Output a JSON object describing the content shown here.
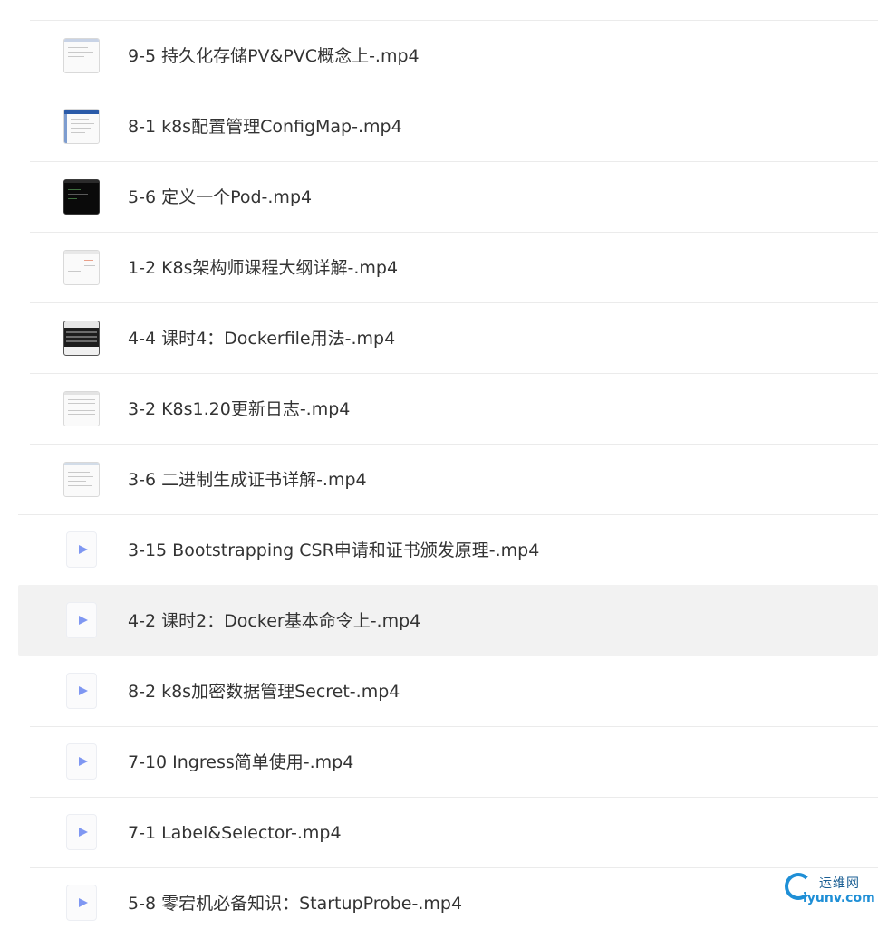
{
  "files": [
    {
      "name": "9-5 持久化存储PV&PVC概念上-.mp4",
      "thumb": "document-thumbnail",
      "selected": false
    },
    {
      "name": "8-1 k8s配置管理ConfigMap-.mp4",
      "thumb": "document-thumbnail",
      "selected": false
    },
    {
      "name": "5-6 定义一个Pod-.mp4",
      "thumb": "terminal-thumbnail",
      "selected": false
    },
    {
      "name": "1-2 K8s架构师课程大纲详解-.mp4",
      "thumb": "document-thumbnail",
      "selected": false
    },
    {
      "name": "4-4 课时4：Dockerfile用法-.mp4",
      "thumb": "table-thumbnail",
      "selected": false
    },
    {
      "name": "3-2 K8s1.20更新日志-.mp4",
      "thumb": "document-thumbnail",
      "selected": false
    },
    {
      "name": "3-6 二进制生成证书详解-.mp4",
      "thumb": "document-thumbnail",
      "selected": false
    },
    {
      "name": "3-15 Bootstrapping CSR申请和证书颁发原理-.mp4",
      "thumb": "video-file-icon",
      "selected": false
    },
    {
      "name": "4-2 课时2：Docker基本命令上-.mp4",
      "thumb": "video-file-icon",
      "selected": true
    },
    {
      "name": "8-2 k8s加密数据管理Secret-.mp4",
      "thumb": "video-file-icon",
      "selected": false
    },
    {
      "name": "7-10 Ingress简单使用-.mp4",
      "thumb": "video-file-icon",
      "selected": false
    },
    {
      "name": "7-1 Label&Selector-.mp4",
      "thumb": "video-file-icon",
      "selected": false
    },
    {
      "name": "5-8 零宕机必备知识：StartupProbe-.mp4",
      "thumb": "video-file-icon",
      "selected": false
    }
  ],
  "watermark": {
    "cn": "运维网",
    "en": "iyunv.com",
    "color": "#1f8fd6"
  },
  "colors": {
    "selected_row": "#f2f2f2",
    "separator": "#ebebeb",
    "play_icon": "#7f97f2",
    "text": "#333333"
  }
}
